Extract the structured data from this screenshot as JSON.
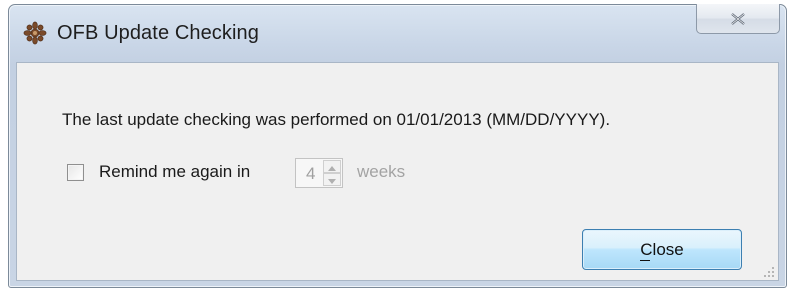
{
  "window": {
    "title": "OFB Update Checking",
    "icon": "ofb-app-icon",
    "close_icon": "close-x-icon"
  },
  "dialog": {
    "message": "The last update checking was performed on 01/01/2013 (MM/DD/YYYY).",
    "remind": {
      "checked": false,
      "label": "Remind me again in",
      "value": "4",
      "unit_label": "weeks",
      "enabled": false
    },
    "close_button_label": "Close"
  },
  "colors": {
    "accent": "#3c7fb1",
    "disabled_text": "#a3a3a3"
  }
}
